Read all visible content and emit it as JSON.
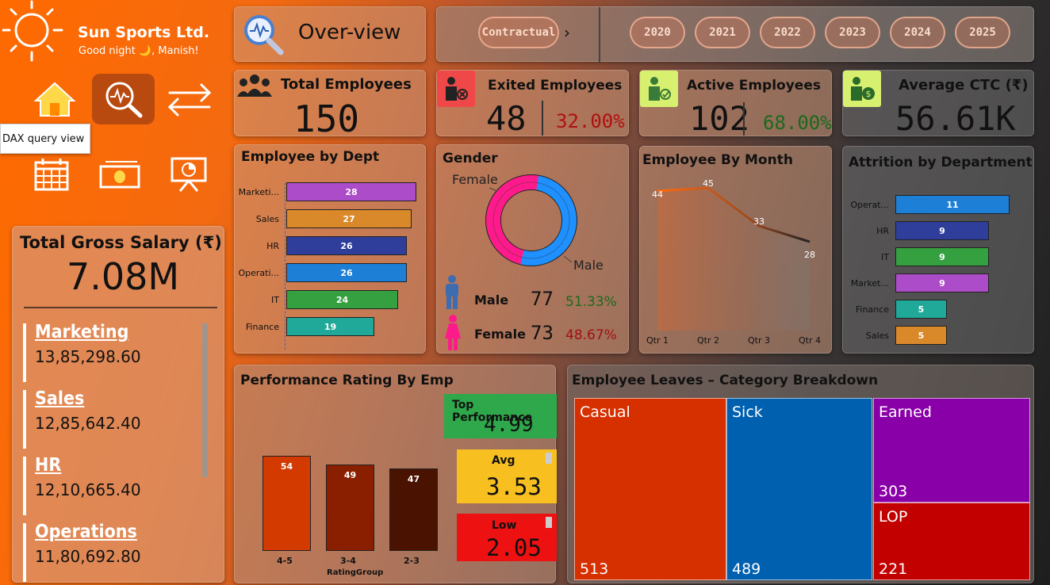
{
  "brand": {
    "name": "Sun Sports Ltd.",
    "greeting": "Good night 🌙, Manish!"
  },
  "nav": {
    "tooltip": "DAX query view",
    "icons": [
      "home-icon",
      "analytics-icon",
      "swap-arrows-icon",
      "calendar-icon",
      "money-icon",
      "presentation-icon"
    ]
  },
  "header": {
    "page_title": "Over-view",
    "filter_label": "Contractual",
    "years": [
      "2020",
      "2021",
      "2022",
      "2023",
      "2024",
      "2025"
    ]
  },
  "kpis": {
    "total_employees": {
      "label": "Total Employees",
      "value": "150"
    },
    "exited": {
      "label": "Exited Employees",
      "value": "48",
      "pct": "32.00%"
    },
    "active": {
      "label": "Active Employees",
      "value": "102",
      "pct": "68.00%"
    },
    "avg_ctc": {
      "label": "Average CTC (₹)",
      "value": "56.61K"
    }
  },
  "gross_salary": {
    "label": "Total Gross Salary (₹)",
    "value": "7.08M",
    "items": [
      {
        "name": "Marketing",
        "value": "13,85,298.60"
      },
      {
        "name": "Sales",
        "value": "12,85,642.40"
      },
      {
        "name": "HR",
        "value": "12,10,665.40"
      },
      {
        "name": "Operations",
        "value": "11,80,692.80"
      }
    ]
  },
  "chart_data": [
    {
      "type": "bar",
      "title": "Employee by Dept",
      "categories": [
        "Marketi...",
        "Sales",
        "HR",
        "Operati...",
        "IT",
        "Finance"
      ],
      "values": [
        28,
        27,
        26,
        26,
        24,
        19
      ],
      "colors": [
        "#ad4cc8",
        "#d9892a",
        "#2e3e9a",
        "#1e7fd6",
        "#35a040",
        "#20a898"
      ]
    },
    {
      "type": "pie",
      "title": "Gender",
      "categories": [
        "Male",
        "Female"
      ],
      "values": [
        77,
        73
      ],
      "percents": [
        "51.33%",
        "48.67%"
      ],
      "colors": [
        "#1e90ff",
        "#ff1a8c"
      ]
    },
    {
      "type": "area",
      "title": "Employee By Month",
      "categories": [
        "Qtr 1",
        "Qtr 2",
        "Qtr 3",
        "Qtr 4"
      ],
      "values": [
        44,
        45,
        33,
        28
      ]
    },
    {
      "type": "bar",
      "title": "Attrition by Department",
      "categories": [
        "Operat...",
        "HR",
        "IT",
        "Market...",
        "Finance",
        "Sales"
      ],
      "values": [
        11,
        9,
        9,
        9,
        5,
        5
      ],
      "colors": [
        "#1e7fd6",
        "#2e3e9a",
        "#35a040",
        "#ad4cc8",
        "#20a898",
        "#d9892a"
      ]
    },
    {
      "type": "bar",
      "title": "Performance Rating By Emp",
      "xlabel": "RatingGroup",
      "categories": [
        "4-5",
        "3-4",
        "2-3"
      ],
      "values": [
        54,
        49,
        47
      ],
      "colors": [
        "#d33a00",
        "#8a1f00",
        "#4a1200"
      ]
    },
    {
      "type": "heatmap",
      "title": "Employee Leaves – Category Breakdown",
      "categories": [
        "Casual",
        "Sick",
        "Earned",
        "LOP"
      ],
      "values": [
        513,
        489,
        303,
        221
      ],
      "colors": [
        "#d63000",
        "#0060b0",
        "#8a00a8",
        "#c20000"
      ]
    }
  ],
  "performance": {
    "top": {
      "label": "Top Performance",
      "value": "4.99",
      "color": "#2ea84a"
    },
    "avg": {
      "label": "Avg",
      "value": "3.53",
      "color": "#f7c020"
    },
    "low": {
      "label": "Low",
      "value": "2.05",
      "color": "#ee1111"
    }
  }
}
